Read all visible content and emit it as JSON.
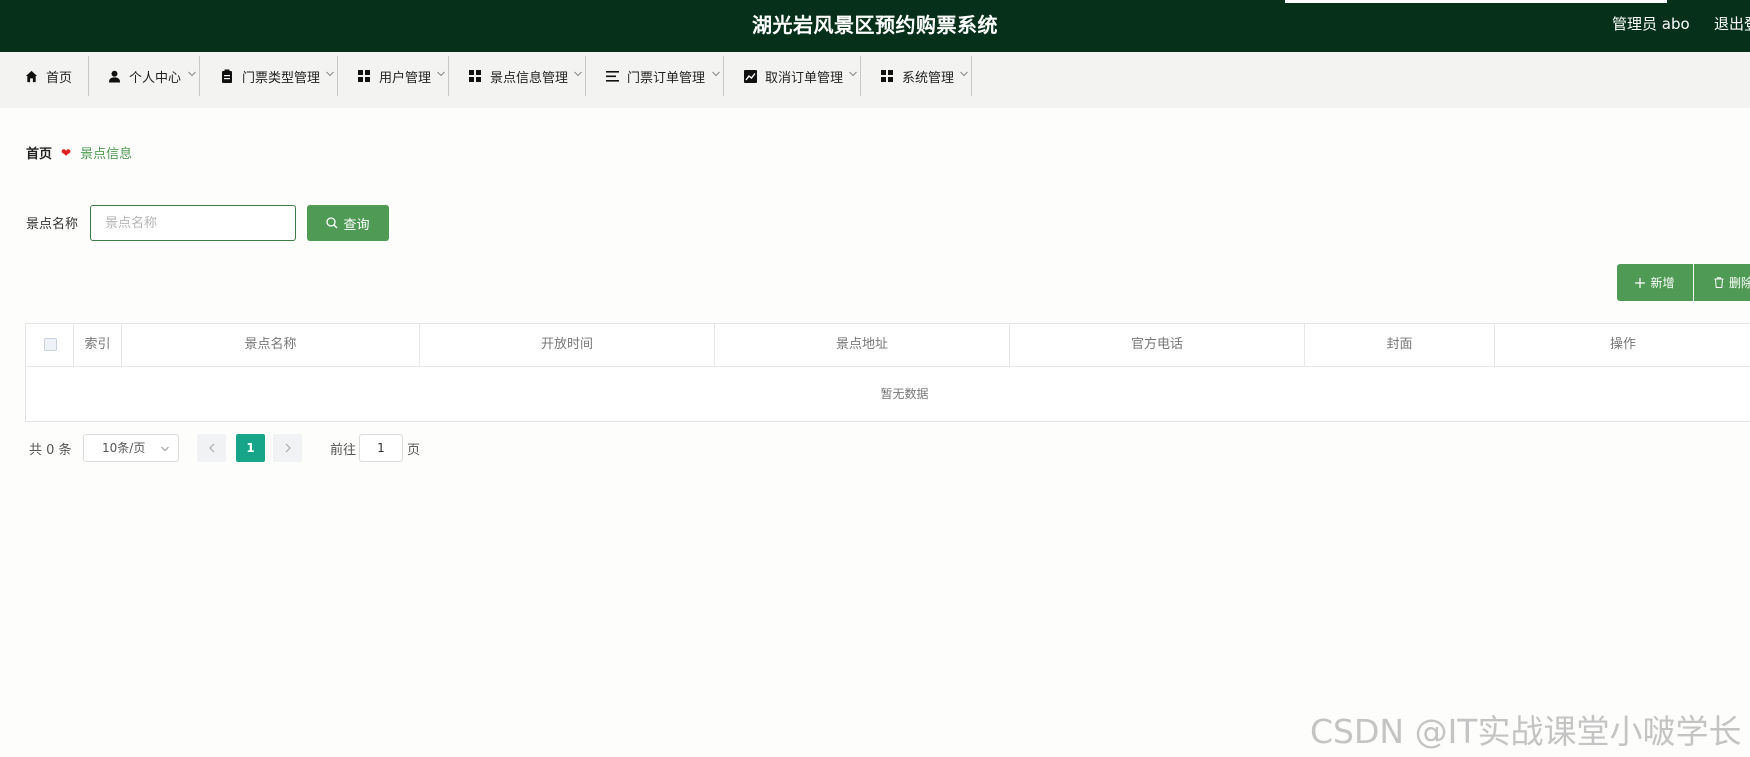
{
  "header": {
    "title": "湖光岩风景区预约购票系统",
    "user": "管理员 abo",
    "logout": "退出登"
  },
  "nav": {
    "items": [
      {
        "label": "首页",
        "icon": "home-icon"
      },
      {
        "label": "个人中心",
        "icon": "person-icon"
      },
      {
        "label": "门票类型管理",
        "icon": "clipboard-icon"
      },
      {
        "label": "用户管理",
        "icon": "grid-icon"
      },
      {
        "label": "景点信息管理",
        "icon": "grid-icon"
      },
      {
        "label": "门票订单管理",
        "icon": "list-icon"
      },
      {
        "label": "取消订单管理",
        "icon": "chart-icon"
      },
      {
        "label": "系统管理",
        "icon": "grid-icon"
      }
    ]
  },
  "breadcrumb": {
    "home": "首页",
    "current": "景点信息"
  },
  "search": {
    "label": "景点名称",
    "placeholder": "景点名称",
    "value": "",
    "button": "查询"
  },
  "actions": {
    "add": "新增",
    "delete": "删除"
  },
  "table": {
    "columns": [
      "索引",
      "景点名称",
      "开放时间",
      "景点地址",
      "官方电话",
      "封面",
      "操作"
    ],
    "empty_text": "暂无数据"
  },
  "pagination": {
    "total": "共 0 条",
    "page_size": "10条/页",
    "current_page": "1",
    "goto_label": "前往",
    "goto_value": "1",
    "page_suffix": "页"
  },
  "watermark": "CSDN @IT实战课堂小啵学长",
  "colors": {
    "header_bg": "#06301a",
    "accent_green": "#4f9a55",
    "page_active": "#17a589"
  }
}
